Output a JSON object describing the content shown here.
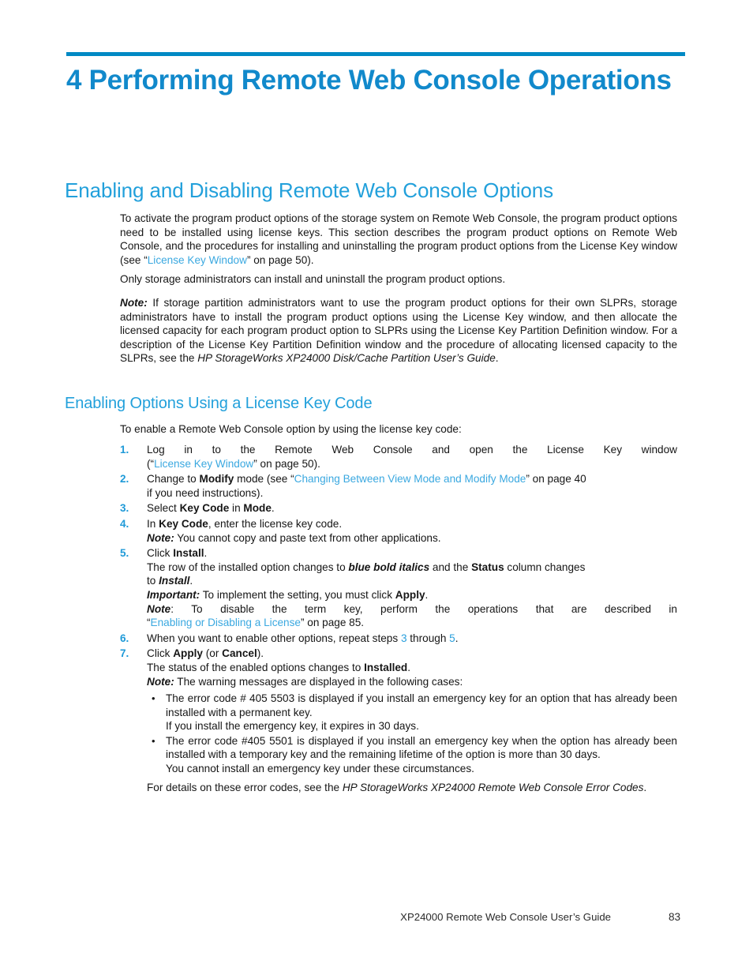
{
  "document": {
    "footer_title": "XP24000 Remote Web Console User’s Guide",
    "footer_page": "83"
  },
  "colors": {
    "rule": "#0089c4",
    "chapter_title": "#1189cb",
    "heading": "#22a0db",
    "cross_reference": "#3aa8e0",
    "step_number": "#1f9ad8",
    "body_text": "#161616"
  },
  "chapter": {
    "number": "4",
    "title": "4 Performing Remote Web Console Operations"
  },
  "section": {
    "heading": "Enabling and Disabling Remote Web Console Options",
    "intro_paragraph": {
      "part1": "To activate the program product options of the storage system on Remote Web Console, the program product options need to be installed using license keys.  This section describes the program product options on Remote Web Console, and the procedures for installing and uninstalling the program product options from the License Key window (see “",
      "link": "License Key Window",
      "part2": "” on page 50)."
    },
    "admin_paragraph": "Only storage administrators can install and uninstall the program product options.",
    "note_paragraph": {
      "label": "Note:",
      "text": " If storage partition administrators want to use the program product options for their own SLPRs, storage administrators have to install the program product options using the License Key window, and then allocate the licensed capacity for each program product option to SLPRs using the License Key Partition Definition window.  For a description of the License Key Partition Definition window and the procedure of allocating licensed capacity to the SLPRs, see the ",
      "book_title": "HP StorageWorks XP24000 Disk/Cache Partition User’s Guide",
      "tail": "."
    }
  },
  "subsection": {
    "heading": "Enabling Options Using a License Key Code",
    "lead_in": "To enable a Remote Web Console option by using the license key code:",
    "steps": [
      {
        "num": "1.",
        "line1": "Log in to the Remote Web Console and open the License Key window",
        "line2_pre": "(“",
        "line2_link": "License Key Window",
        "line2_post": "” on page 50)."
      },
      {
        "num": "2.",
        "pre": "Change to ",
        "bold1": "Modify",
        "mid": " mode (see “",
        "link": "Changing Between View Mode and Modify Mode",
        "post": "” on page 40",
        "line2": "if you need instructions)."
      },
      {
        "num": "3.",
        "pre": "Select ",
        "bold1": "Key Code",
        "mid": " in ",
        "bold2": "Mode",
        "post": "."
      },
      {
        "num": "4.",
        "pre": "In ",
        "bold1": "Key Code",
        "post": ", enter the license key code.",
        "note_label": "Note:",
        "note_text": " You cannot copy and paste text from other applications."
      },
      {
        "num": "5.",
        "pre": "Click ",
        "bold1": "Install",
        "post": ".",
        "result_pre": "The row of the installed option changes to ",
        "result_bi": "blue bold italics",
        "result_mid": " and the ",
        "result_bold": "Status",
        "result_post": " column changes",
        "result_line2_pre": "to ",
        "result_line2_bi": "Install",
        "result_line2_post": ".",
        "important_label": "Important:",
        "important_pre": " To implement the setting, you must click ",
        "important_bold": "Apply",
        "important_post": ".",
        "note_label": "Note",
        "note_text": ":  To disable the term key, perform the operations that are described in",
        "note_link_pre": "“",
        "note_link": "Enabling or Disabling a License",
        "note_link_post": "” on page 85."
      },
      {
        "num": "6.",
        "pre": "When you want to enable other options, repeat steps ",
        "ref1": "3",
        "mid": " through ",
        "ref2": "5",
        "post": "."
      },
      {
        "num": "7.",
        "pre": "Click ",
        "bold1": "Apply",
        "mid": " (or ",
        "bold2": "Cancel",
        "post": ").",
        "status_pre": "The status of the enabled options changes to ",
        "status_bold": "Installed",
        "status_post": ".",
        "note_label": "Note:",
        "note_text": " The warning messages are displayed in the following cases:",
        "bullets": [
          {
            "marker": "•",
            "line1": "The error code # 405 5503 is displayed if you install an emergency key for an option that has already been installed with a permanent key.",
            "line2": "If you install the emergency key, it expires in 30 days."
          },
          {
            "marker": "•",
            "line1": "The error code #405 5501 is displayed if you install an emergency key when the option has already been installed with a temporary key and the remaining lifetime of the option is more than 30 days.",
            "line2": "You cannot install an emergency key under these circumstances."
          }
        ],
        "closing_pre": "For details on these error codes, see the ",
        "closing_italic": "HP StorageWorks XP24000 Remote Web Console Error Codes",
        "closing_post": "."
      }
    ]
  }
}
